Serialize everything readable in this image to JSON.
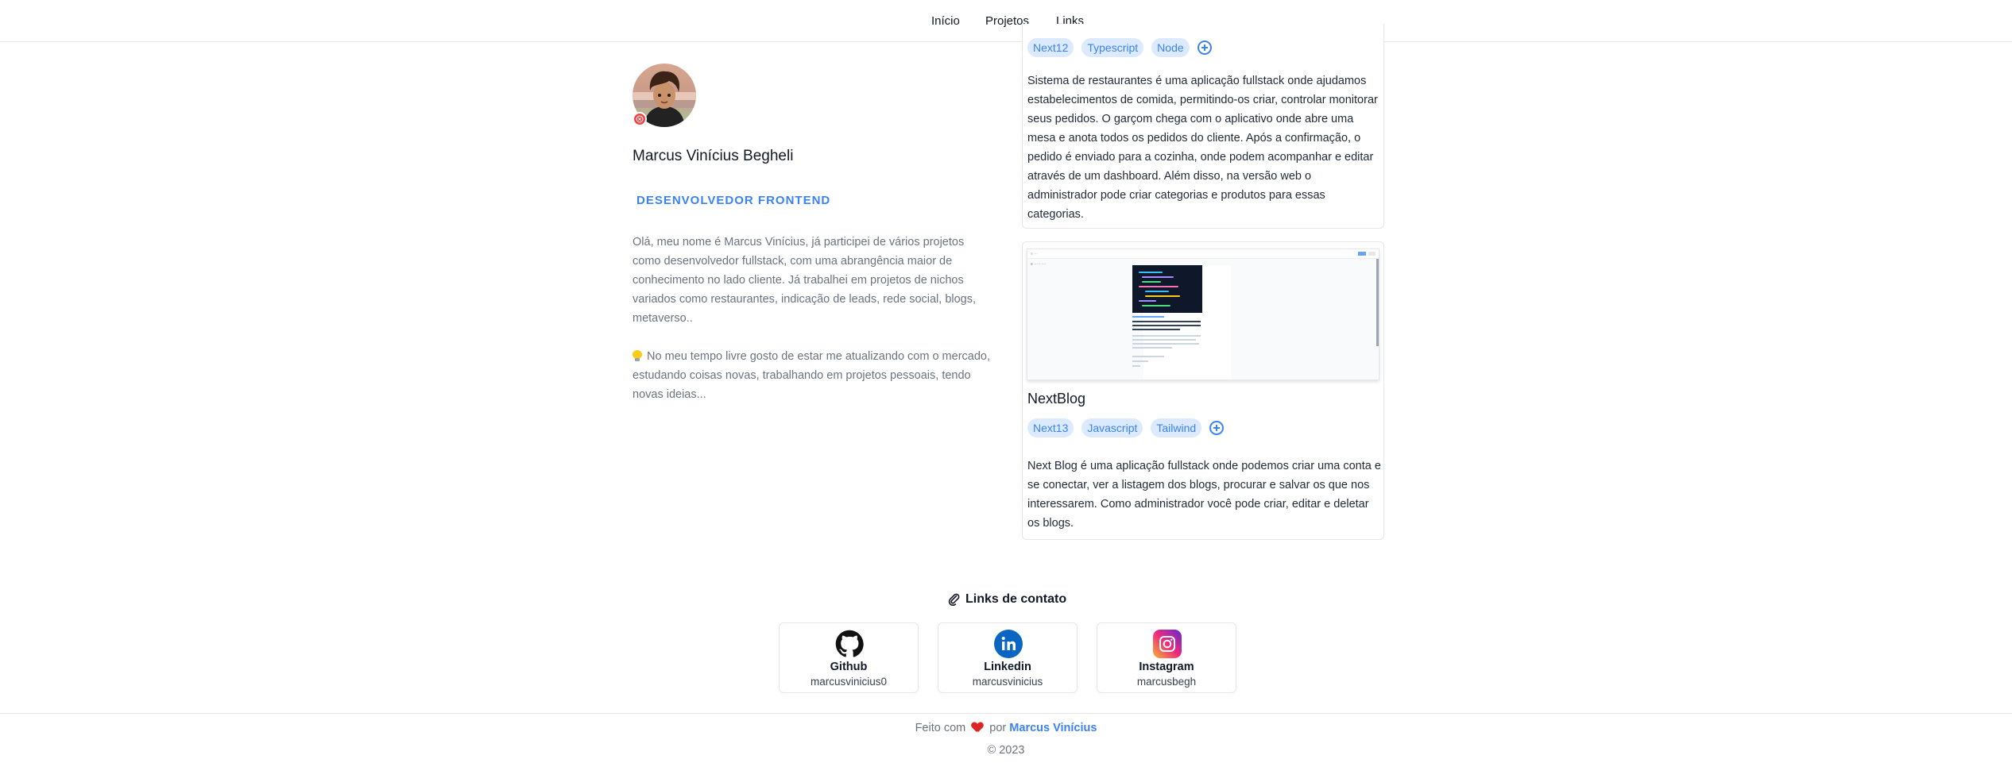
{
  "nav": {
    "items": [
      "Início",
      "Projetos",
      "Links"
    ]
  },
  "profile": {
    "name": "Marcus Vinícius Begheli",
    "role": "DESENVOLVEDOR FRONTEND",
    "bio_1": "Olá, meu nome é Marcus Vinícius, já participei de vários projetos como desenvolvedor fullstack, com uma abrangência maior de conhecimento no lado cliente. Já trabalhei em projetos de nichos variados como restaurantes, indicação de leads, rede social, blogs, metaverso..",
    "bio_2": "No meu tempo livre gosto de estar me atualizando com o mercado, estudando coisas novas, trabalhando em projetos pessoais, tendo novas ideias..."
  },
  "projects": [
    {
      "tags": [
        "Next12",
        "Typescript",
        "Node"
      ],
      "description": "Sistema de restaurantes é uma aplicação fullstack onde ajudamos estabelecimentos de comida, permitindo-os criar, controlar monitorar seus pedidos. O garçom chega com o aplicativo onde abre uma mesa e anota todos os pedidos do cliente. Após a confirmação, o pedido é enviado para a cozinha, onde podem acompanhar e editar através de um dashboard. Além disso, na versão web o administrador pode criar categorias e produtos para essas categorias."
    },
    {
      "title": "NextBlog",
      "tags": [
        "Next13",
        "Javascript",
        "Tailwind"
      ],
      "description": "Next Blog é uma aplicação fullstack onde podemos criar uma conta e se conectar, ver a listagem dos blogs, procurar e salvar os que nos interessarem. Como administrador você pode criar, editar e deletar os blogs."
    }
  ],
  "contact": {
    "title": "Links de contato",
    "links": [
      {
        "name": "Github",
        "user": "marcusvinicius0",
        "icon": "github-icon"
      },
      {
        "name": "Linkedin",
        "user": "marcusvinicius",
        "icon": "linkedin-icon"
      },
      {
        "name": "Instagram",
        "user": "marcusbegh",
        "icon": "instagram-icon"
      }
    ]
  },
  "footer": {
    "made_with": "Feito com",
    "by": "por",
    "author": "Marcus Vinícius",
    "copyright": "© 2023"
  },
  "colors": {
    "accent": "#3b82f6",
    "tag_bg": "#dbeafe",
    "status": "#ef4444"
  }
}
